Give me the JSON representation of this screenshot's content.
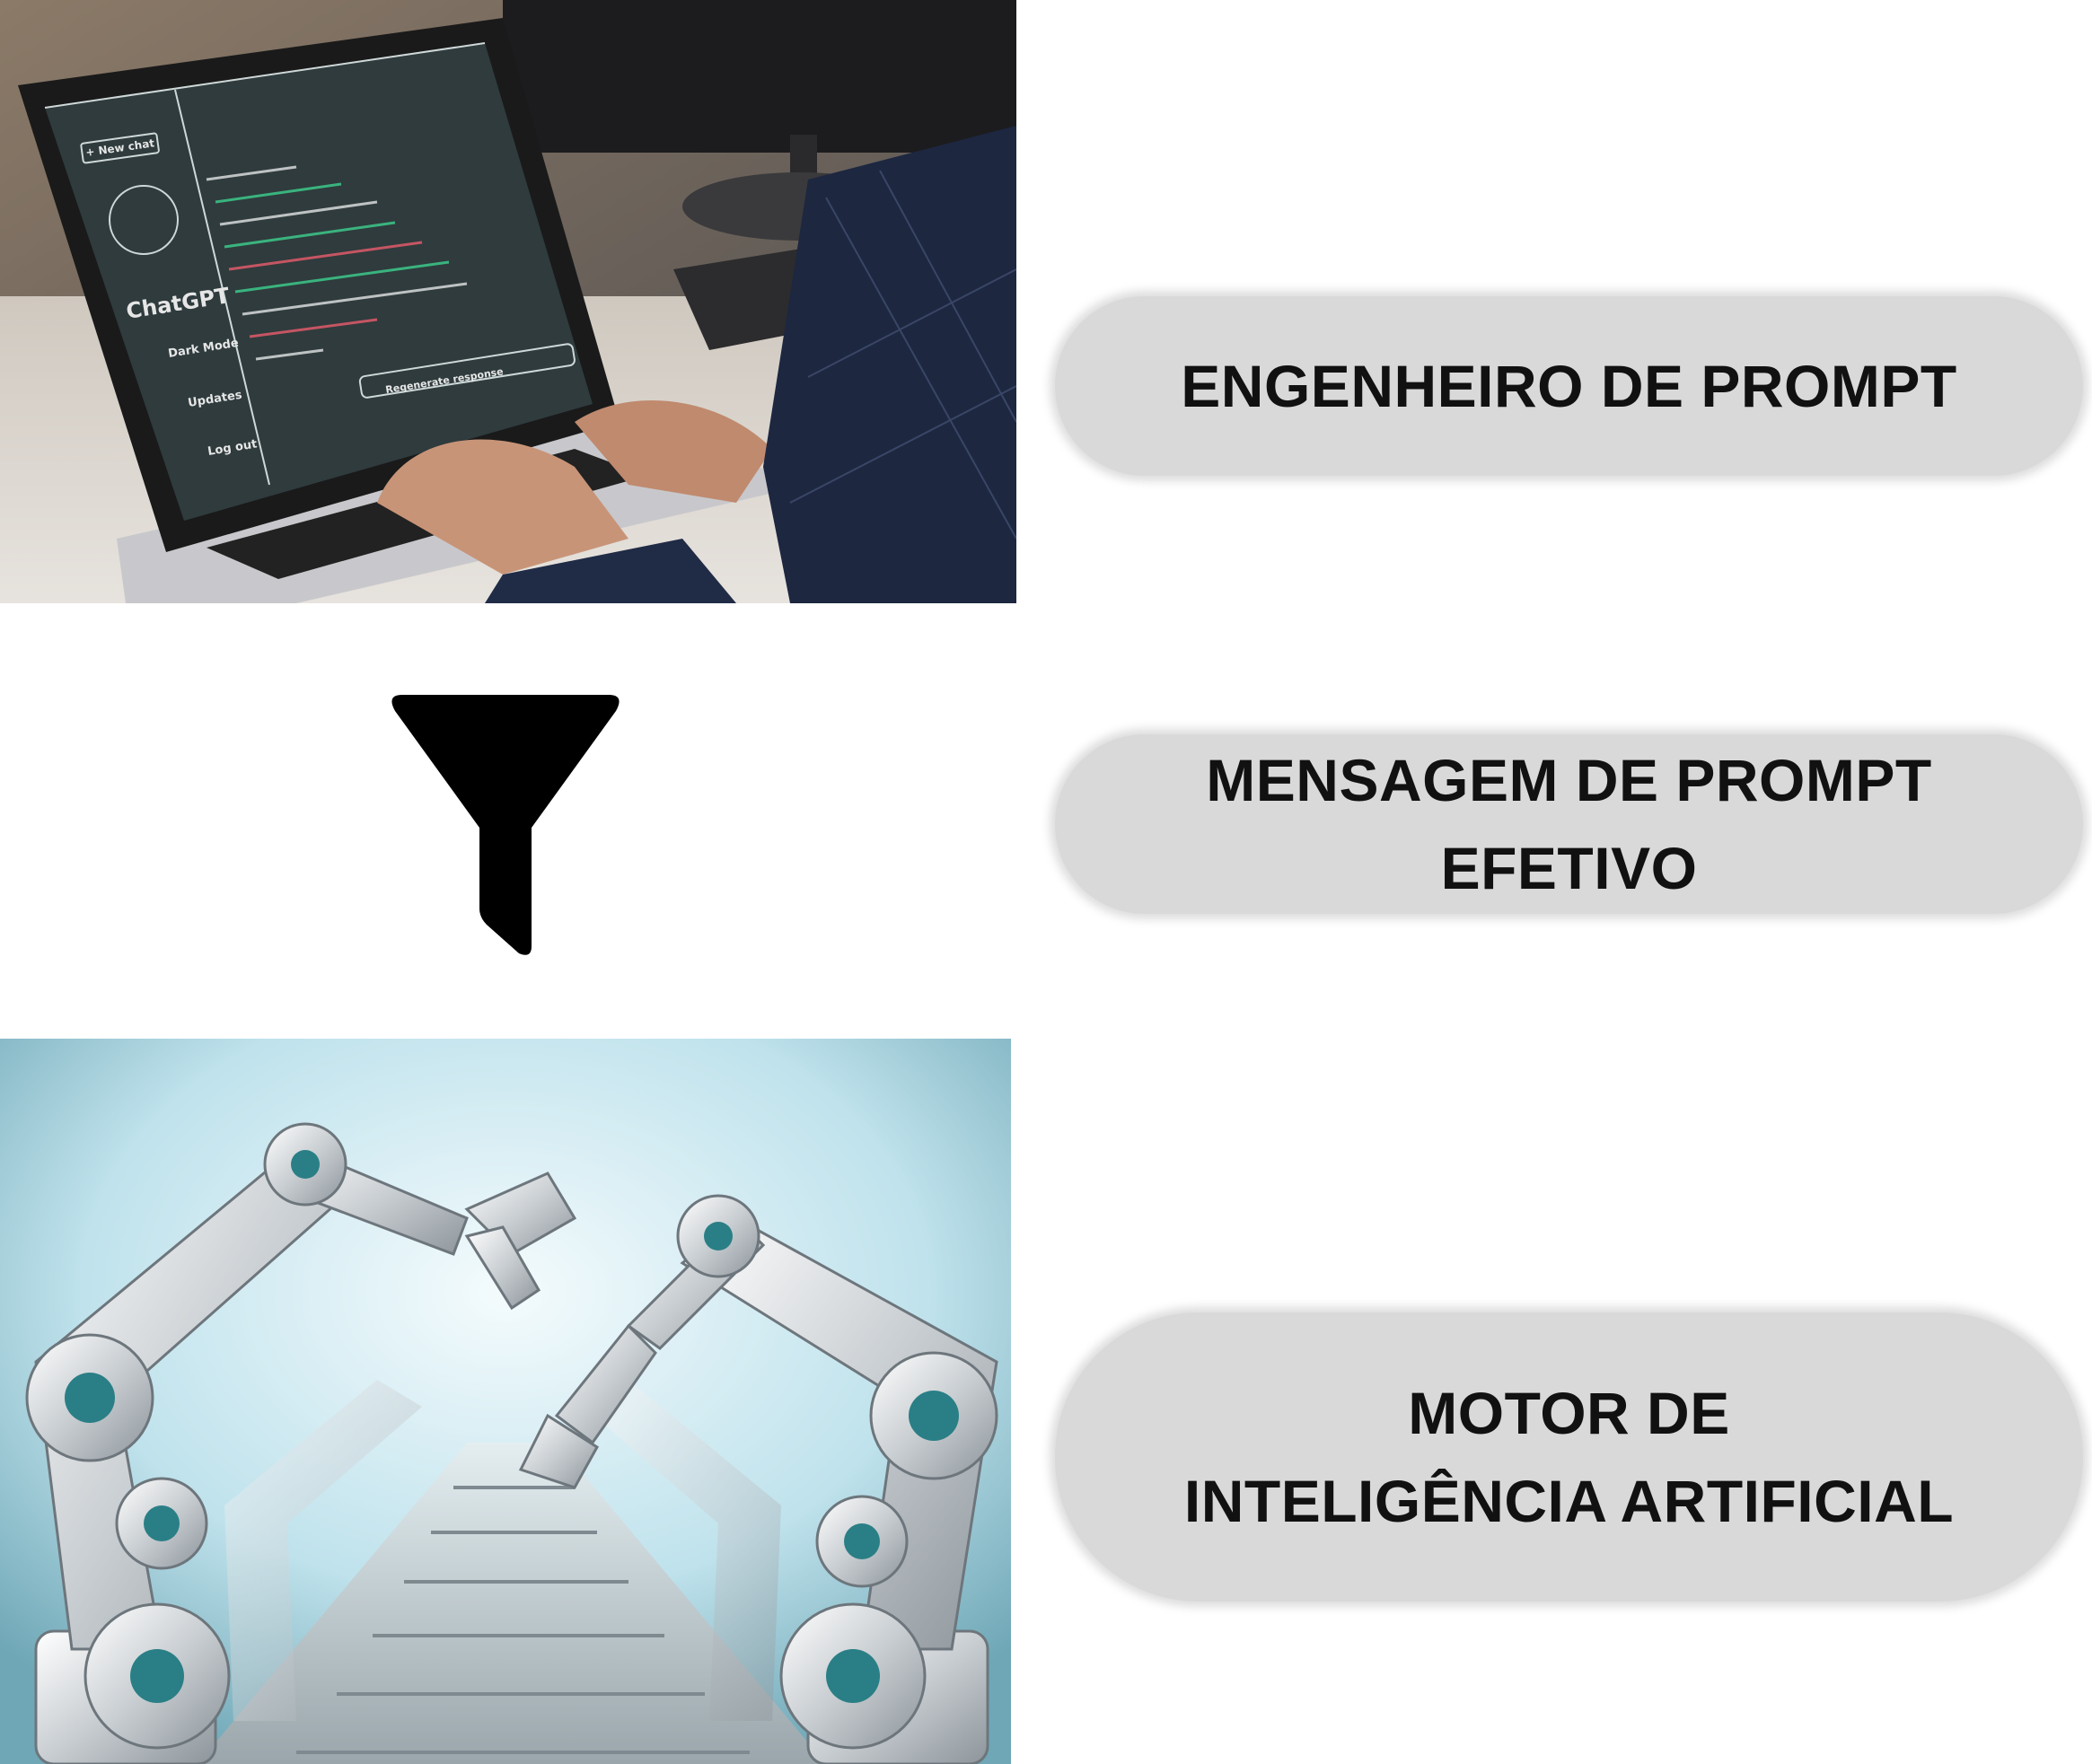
{
  "steps": [
    {
      "label_lines": [
        "ENGENHEIRO DE PROMPT"
      ]
    },
    {
      "label_lines": [
        "MENSAGEM DE PROMPT",
        "EFETIVO"
      ]
    },
    {
      "label_lines": [
        "MOTOR DE",
        "INTELIGÊNCIA ARTIFICIAL"
      ]
    }
  ],
  "laptop_screen": {
    "new_chat": "+ New chat",
    "app_name": "ChatGPT",
    "menu": [
      "Dark Mode",
      "Updates",
      "Log out"
    ],
    "regenerate": "Regenerate response"
  },
  "icons": {
    "funnel": "funnel-icon"
  },
  "colors": {
    "pill_bg": "#d9d9d9",
    "text": "#111111",
    "funnel": "#000000"
  }
}
